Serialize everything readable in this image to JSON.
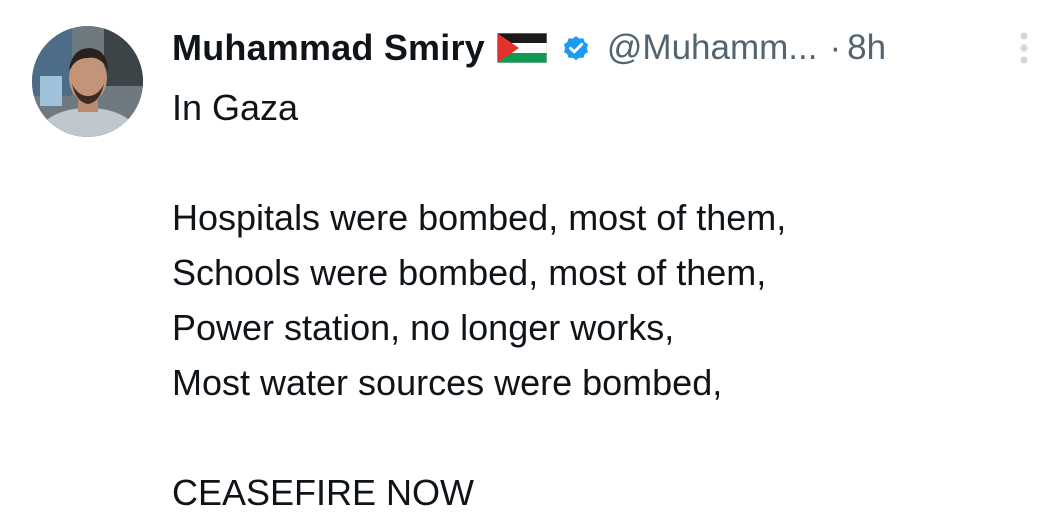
{
  "tweet": {
    "author": {
      "display_name": "Muhammad Smiry",
      "flag": "palestine-flag",
      "verified": true,
      "handle": "@Muhamm...",
      "separator": "·",
      "time": "8h"
    },
    "lines": {
      "l1": "In Gaza",
      "l2": "Hospitals were bombed, most of them,",
      "l3": "Schools were bombed, most of them,",
      "l4": "Power station, no longer works,",
      "l5": "Most water sources were bombed,",
      "l6": "CEASEFIRE NOW"
    },
    "icons": {
      "verified": "verified-badge-icon",
      "more": "more-options-icon"
    },
    "colors": {
      "verified_blue": "#1d9bf0",
      "text_primary": "#0f1419",
      "text_secondary": "#536471"
    }
  }
}
